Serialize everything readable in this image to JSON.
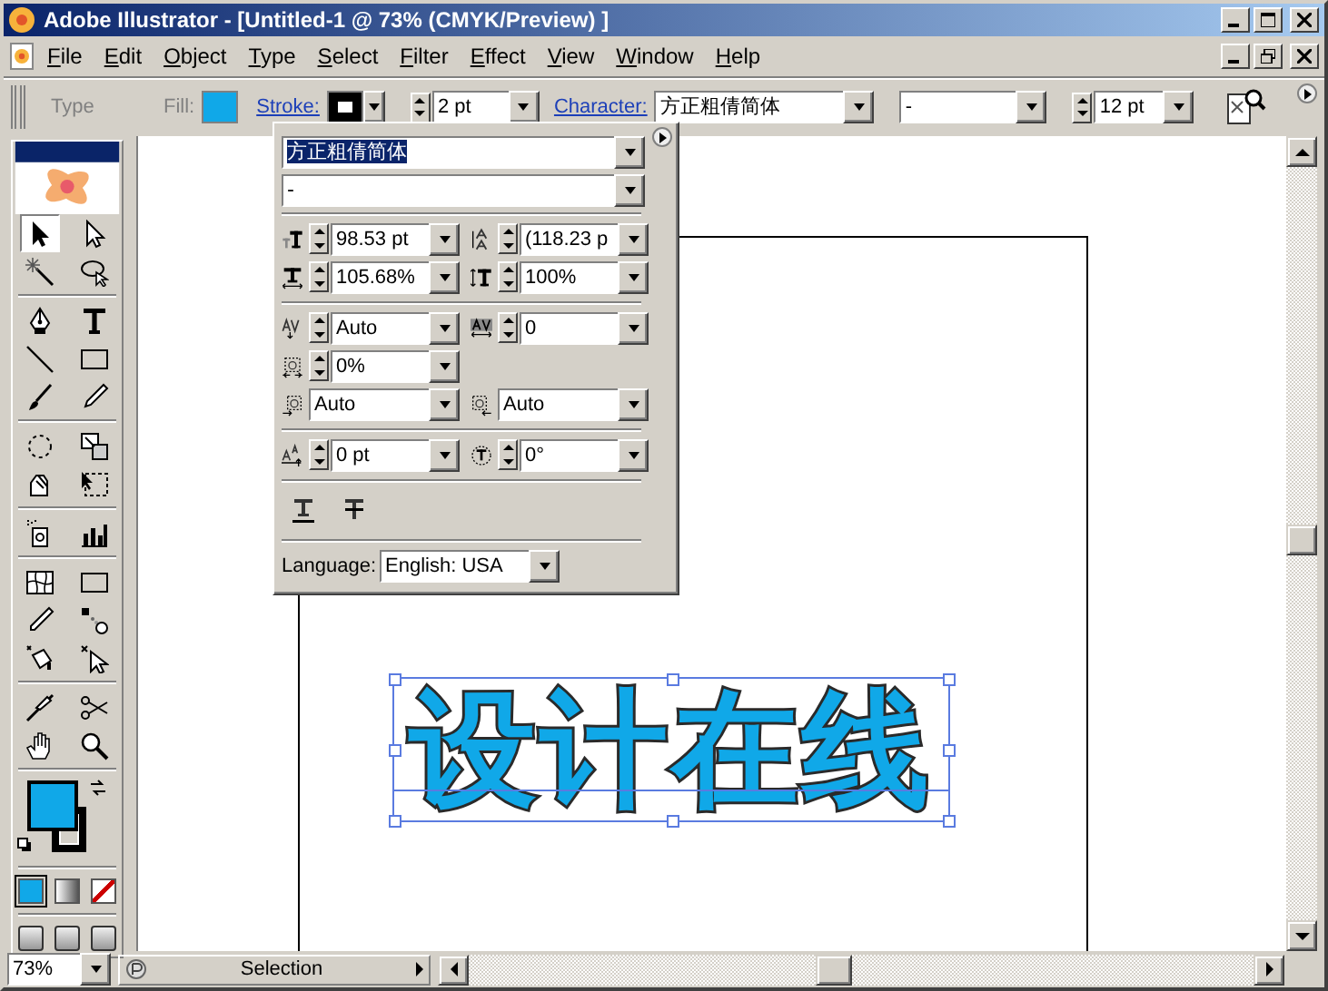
{
  "window": {
    "title": "Adobe Illustrator - [Untitled-1 @ 73% (CMYK/Preview) ]"
  },
  "menu": [
    "File",
    "Edit",
    "Object",
    "Type",
    "Select",
    "Filter",
    "Effect",
    "View",
    "Window",
    "Help"
  ],
  "control_bar": {
    "tool_label": "Type",
    "fill_label": "Fill:",
    "stroke_label": "Stroke:",
    "stroke_weight": "2 pt",
    "character_link": "Character:",
    "font_family": "方正粗倩简体",
    "font_style": "-",
    "font_size": "12 pt"
  },
  "tools": [
    {
      "selected": true
    },
    {
      "selected": false
    },
    {
      "selected": false
    },
    {
      "selected": false
    },
    {
      "selected": false
    },
    {
      "selected": false
    },
    {
      "selected": false
    },
    {
      "selected": false
    },
    {
      "selected": false
    },
    {
      "selected": false
    },
    {
      "selected": false
    },
    {
      "selected": false
    },
    {
      "selected": false
    },
    {
      "selected": false
    },
    {
      "selected": false
    },
    {
      "selected": false
    },
    {
      "selected": false
    },
    {
      "selected": false
    },
    {
      "selected": false
    },
    {
      "selected": false
    },
    {
      "selected": false
    },
    {
      "selected": false
    },
    {
      "selected": false
    },
    {
      "selected": false
    },
    {
      "selected": false
    },
    {
      "selected": false
    }
  ],
  "character_panel": {
    "font_family": {
      "value": "方正粗倩简体",
      "highlighted": true
    },
    "font_style": "-",
    "sections": [
      [
        [
          {
            "kind": "font-size",
            "value": "98.53 pt"
          },
          {
            "kind": "leading",
            "value": "(118.23 p"
          }
        ],
        [
          {
            "kind": "horizontal-scale",
            "value": "105.68%"
          },
          {
            "kind": "vertical-scale",
            "value": "100%"
          }
        ]
      ],
      [
        [
          {
            "kind": "kerning",
            "value": "Auto"
          },
          {
            "kind": "tracking",
            "value": "0"
          }
        ],
        [
          {
            "kind": "tsume",
            "value": "0%"
          }
        ],
        [
          {
            "kind": "aki-left",
            "value": "Auto"
          },
          {
            "kind": "aki-right",
            "value": "Auto"
          }
        ]
      ],
      [
        [
          {
            "kind": "baseline-shift",
            "value": "0 pt"
          },
          {
            "kind": "rotation",
            "value": "0°"
          }
        ]
      ]
    ],
    "language_label": "Language:",
    "language": "English: USA"
  },
  "artwork": {
    "text": "设计在线",
    "selected": true
  },
  "status_bar": {
    "zoom": "73%",
    "status": "Selection"
  }
}
